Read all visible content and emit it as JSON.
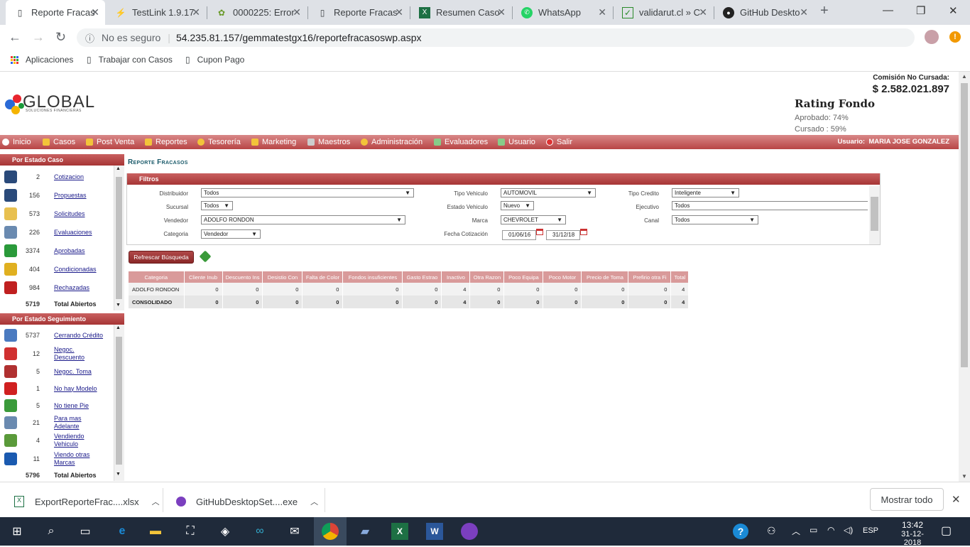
{
  "browser": {
    "tabs": [
      {
        "title": "Reporte Fracas",
        "icon": "page-icon",
        "active": true
      },
      {
        "title": "TestLink 1.9.17",
        "icon": "testlink-icon"
      },
      {
        "title": "0000225: Error",
        "icon": "mantis-icon"
      },
      {
        "title": "Reporte Fracas",
        "icon": "page-icon"
      },
      {
        "title": "Resumen Caso",
        "icon": "excel-icon"
      },
      {
        "title": "WhatsApp",
        "icon": "whatsapp-icon"
      },
      {
        "title": "validarut.cl » C",
        "icon": "check-icon"
      },
      {
        "title": "GitHub Deskto",
        "icon": "github-icon"
      }
    ],
    "security": "No es seguro",
    "url": "54.235.81.157/gemmatestgx16/reportefracasoswp.aspx",
    "bookmarks": [
      "Aplicaciones",
      "Trabajar con Casos",
      "Cupon Pago"
    ]
  },
  "header": {
    "logo_text": "GLOBAL",
    "logo_sub": "SOLUCIONES FINANCIERAS",
    "commission_label": "Comisión No Cursada:",
    "commission_value": "$ 2.582.021.897",
    "rating_title": "Rating Fondo",
    "approved": "Aprobado: 74%",
    "cursado": "Cursado : 59%"
  },
  "menu": {
    "items": [
      "Inicio",
      "Casos",
      "Post Venta",
      "Reportes",
      "Tesorería",
      "Marketing",
      "Maestros",
      "Administración",
      "Evaluadores",
      "Usuario",
      "Salir"
    ],
    "user_label": "Usuario:",
    "user_name": "MARIA JOSE GONZALEZ"
  },
  "sidebar": {
    "case_header": "Por Estado Caso",
    "case_items": [
      {
        "count": "2",
        "label": "Cotizacion",
        "icon": "calculator-icon"
      },
      {
        "count": "156",
        "label": "Propuestas",
        "icon": "calculator-icon"
      },
      {
        "count": "573",
        "label": "Solicitudes",
        "icon": "document-icon"
      },
      {
        "count": "226",
        "label": "Evaluaciones",
        "icon": "magnifier-icon"
      },
      {
        "count": "3374",
        "label": "Aprobadas",
        "icon": "shield-check-icon"
      },
      {
        "count": "404",
        "label": "Condicionadas",
        "icon": "shield-warning-icon"
      },
      {
        "count": "984",
        "label": "Rechazadas",
        "icon": "shield-x-icon"
      }
    ],
    "case_total": "5719",
    "case_total_label": "Total Abiertos",
    "follow_header": "Por Estado Seguimiento",
    "follow_items": [
      {
        "count": "5737",
        "label": "Cerrando Crédito",
        "icon": "pen-icon"
      },
      {
        "count": "12",
        "label": "Negoc. Descuento",
        "icon": "percent-icon"
      },
      {
        "count": "5",
        "label": "Negoc. Toma",
        "icon": "car-icon"
      },
      {
        "count": "1",
        "label": "No hay Modelo",
        "icon": "x-circle-icon"
      },
      {
        "count": "5",
        "label": "No tiene Pie",
        "icon": "money-icon"
      },
      {
        "count": "21",
        "label": "Para mas Adelante",
        "icon": "calendar-icon"
      },
      {
        "count": "4",
        "label": "Vendiendo Vehiculo",
        "icon": "cash-icon"
      },
      {
        "count": "11",
        "label": "Viendo otras Marcas",
        "icon": "question-icon"
      }
    ],
    "follow_total": "5796",
    "follow_total_label": "Total Abiertos"
  },
  "main": {
    "title": "Reporte Fracasos",
    "filters_title": "Filtros",
    "filters": {
      "distribuidor": {
        "label": "Distribuidor",
        "value": "Todos"
      },
      "sucursal": {
        "label": "Sucursal",
        "value": "Todos"
      },
      "vendedor": {
        "label": "Vendedor",
        "value": "ADOLFO RONDON"
      },
      "categoria": {
        "label": "Categoria",
        "value": "Vendedor"
      },
      "tipo_vehiculo": {
        "label": "Tipo Vehiculo",
        "value": "AUTOMOVIL"
      },
      "estado_vehiculo": {
        "label": "Estado Vehiculo",
        "value": "Nuevo"
      },
      "marca": {
        "label": "Marca",
        "value": "CHEVROLET"
      },
      "fecha": {
        "label": "Fecha Cotización",
        "from": "01/06/16",
        "to": "31/12/18"
      },
      "tipo_credito": {
        "label": "Tipo Credito",
        "value": "Inteligente"
      },
      "ejecutivo": {
        "label": "Ejecutivo",
        "value": "Todos"
      },
      "canal": {
        "label": "Canal",
        "value": "Todos"
      }
    },
    "refresh_button": "Refrescar Búsqueda",
    "table": {
      "headers": [
        "Categoria",
        "Cliente Inub",
        "Descuento Ins",
        "Desistio Con",
        "Falta de Color",
        "Fondos insuficientes",
        "Gasto Estrao",
        "Inactivo",
        "Otra Razon",
        "Poco Equipa",
        "Poco Motor",
        "Precio de Toma",
        "Prefirio otra Fi",
        "Total"
      ],
      "rows": [
        [
          "ADOLFO RONDON",
          "0",
          "0",
          "0",
          "0",
          "0",
          "0",
          "4",
          "0",
          "0",
          "0",
          "0",
          "0",
          "4"
        ],
        [
          "CONSOLIDADO",
          "0",
          "0",
          "0",
          "0",
          "0",
          "0",
          "4",
          "0",
          "0",
          "0",
          "0",
          "0",
          "4"
        ]
      ]
    }
  },
  "downloads": {
    "items": [
      "ExportReporteFrac....xlsx",
      "GitHubDesktopSet....exe"
    ],
    "show_all": "Mostrar todo"
  },
  "taskbar": {
    "time": "13:42",
    "date": "31-12-2018",
    "lang": "ESP"
  }
}
